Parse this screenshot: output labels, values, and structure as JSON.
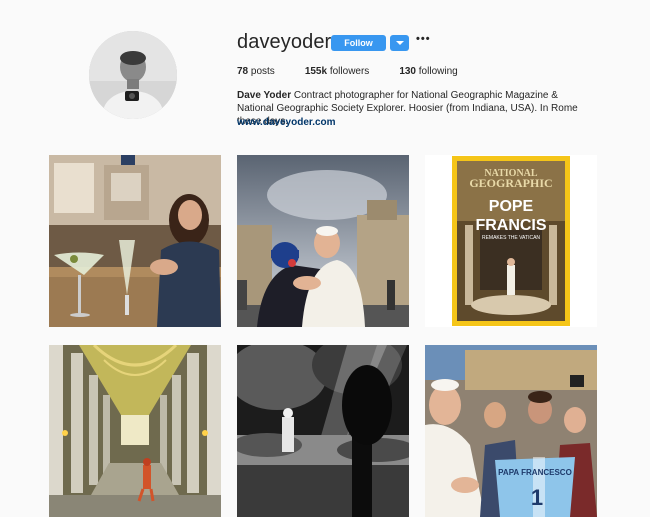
{
  "profile": {
    "username": "daveyoder",
    "follow_label": "Follow",
    "more_label": "•••",
    "stats": {
      "posts_count": "78",
      "posts_label": "posts",
      "followers_count": "155k",
      "followers_label": "followers",
      "following_count": "130",
      "following_label": "following"
    },
    "bio": {
      "name": "Dave Yoder",
      "text": " Contract photographer for National Geographic Magazine & National Geographic Society Explorer. Hoosier (from Indiana, USA). In Rome these days.",
      "website": "www.daveyoder.com"
    }
  },
  "posts": [
    {
      "subject": "woman at cafe table with cocktail"
    },
    {
      "subject": "Pope Francis embracing man in blue cap, St. Peter's Square"
    },
    {
      "subject": "National Geographic magazine cover",
      "cover": {
        "masthead_line1": "NATIONAL",
        "masthead_line2": "GEOGRAPHIC",
        "headline_line1": "POPE",
        "headline_line2": "FRANCIS",
        "subhead": "REMAKES THE VATICAN"
      }
    },
    {
      "subject": "Vatican colonnade with Swiss Guard"
    },
    {
      "subject": "black and white garden with sunbeams"
    },
    {
      "subject": "Pope Francis with crowd and jersey",
      "jersey_text": "PAPA FRANCESCO"
    }
  ],
  "colors": {
    "accent": "#3897f0",
    "link": "#003569",
    "background": "#fafafa",
    "natgeo_yellow": "#f5c518"
  }
}
